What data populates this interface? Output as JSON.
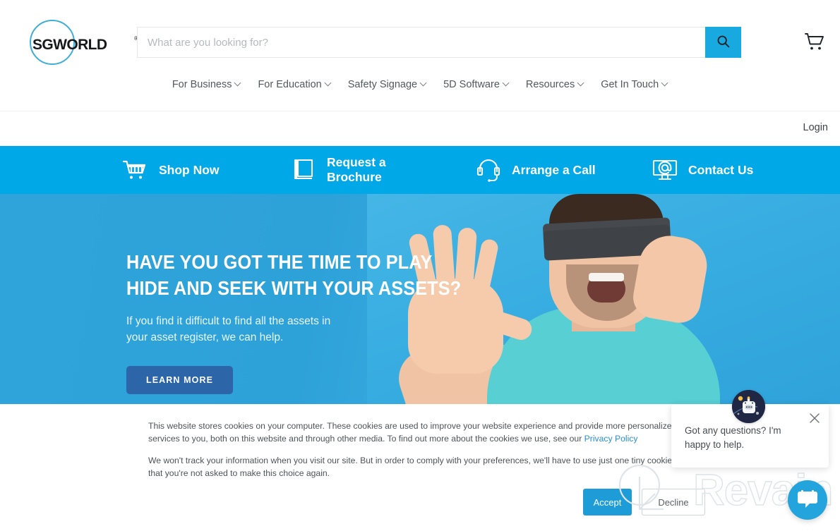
{
  "brand": {
    "logo_text": "SGWORLD",
    "logo_registered_mark": "®",
    "accent_blue": "#00a8e8",
    "search_button_blue": "#17a9e0",
    "hero_button_blue": "#2c65a8",
    "accept_button_blue": "#1e9cd7",
    "link_blue": "#2a8fd0"
  },
  "header": {
    "search": {
      "placeholder": "What are you looking for?",
      "value": "",
      "search_icon": "search-icon",
      "button_label": ""
    },
    "cart_icon": "shopping-cart-icon",
    "nav_items": [
      {
        "label": "For Business",
        "has_dropdown": true
      },
      {
        "label": "For Education",
        "has_dropdown": true
      },
      {
        "label": "Safety Signage",
        "has_dropdown": true
      },
      {
        "label": "5D Software",
        "has_dropdown": true
      },
      {
        "label": "Resources",
        "has_dropdown": true
      },
      {
        "label": "Get In Touch",
        "has_dropdown": true
      }
    ]
  },
  "account_bar": {
    "login_label": "Login"
  },
  "action_bar": {
    "items": [
      {
        "label": "Shop Now",
        "icon": "shopping-cart-icon"
      },
      {
        "label": "Request a Brochure",
        "icon": "brochure-book-icon"
      },
      {
        "label": "Arrange a Call",
        "icon": "headset-icon"
      },
      {
        "label": "Contact Us",
        "icon": "monitor-email-icon"
      }
    ]
  },
  "hero": {
    "headline_line1": "HAVE YOU GOT THE TIME TO PLAY",
    "headline_line2": "HIDE AND SEEK WITH YOUR ASSETS?",
    "subtext_line1": "If you  find it difficult to find all the assets in",
    "subtext_line2": "your asset register, we can help.",
    "cta_label": "LEARN MORE",
    "image_description": "blindfolded-man-with-raised-hand"
  },
  "cookie_banner": {
    "paragraph1_part1": "This website stores cookies on your computer. These cookies are used to improve your website experience and provide more personalized services to you, both on this website and through other media. To find out more about the cookies we use, see our ",
    "privacy_policy_label": "Privacy Policy",
    "paragraph2": "We won't track your information when you visit our site. But in order to comply with your preferences, we'll have to use just one tiny cookie so that you're not asked to make this choice again.",
    "accept_label": "Accept",
    "decline_label": "Decline"
  },
  "chat": {
    "message": "Got any questions? I'm happy to help.",
    "close_icon": "close-icon",
    "avatar_icon": "robot-avatar-icon",
    "launcher_icon": "chat-bubble-icon"
  },
  "watermark": {
    "text": "Revain"
  }
}
